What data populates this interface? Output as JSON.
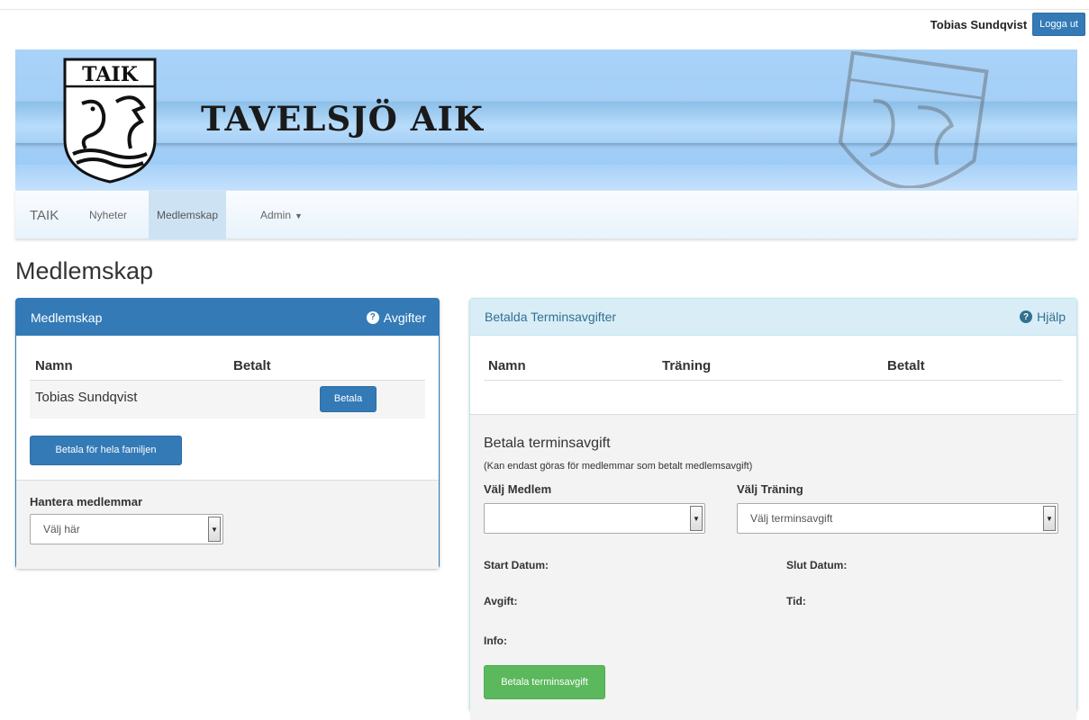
{
  "topbar": {
    "user_name": "Tobias Sundqvist",
    "logout_label": "Logga ut"
  },
  "banner": {
    "club_name": "TAVELSJÖ AIK",
    "logo_text": "TAIK"
  },
  "nav": {
    "brand": "TAIK",
    "items": [
      {
        "label": "Nyheter"
      },
      {
        "label": "Medlemskap",
        "active": true
      },
      {
        "label": "Admin"
      }
    ]
  },
  "page": {
    "title": "Medlemskap"
  },
  "membership_panel": {
    "title": "Medlemskap",
    "help_label": "Avgifter",
    "columns": [
      "Namn",
      "Betalt"
    ],
    "rows": [
      {
        "name": "Tobias Sundqvist",
        "action": "Betala"
      }
    ],
    "family_button": "Betala för hela familjen",
    "manage_label": "Hantera medlemmar",
    "manage_select": "Välj här"
  },
  "fees_panel": {
    "title": "Betalda Terminsavgifter",
    "help_label": "Hjälp",
    "columns": [
      "Namn",
      "Träning",
      "Betalt"
    ],
    "pay_title": "Betala terminsavgift",
    "pay_note": "(Kan endast göras för medlemmar som betalt medlemsavgift)",
    "member_label": "Välj Medlem",
    "member_select": "",
    "training_label": "Välj Träning",
    "training_select": "Välj terminsavgift",
    "start_label": "Start Datum:",
    "end_label": "Slut Datum:",
    "fee_label": "Avgift:",
    "time_label": "Tid:",
    "info_label": "Info:",
    "pay_button": "Betala terminsavgift"
  },
  "colors": {
    "primary": "#337ab7",
    "info_bg": "#d9edf7",
    "success": "#5cb85c",
    "banner": "#a9d2f7"
  }
}
